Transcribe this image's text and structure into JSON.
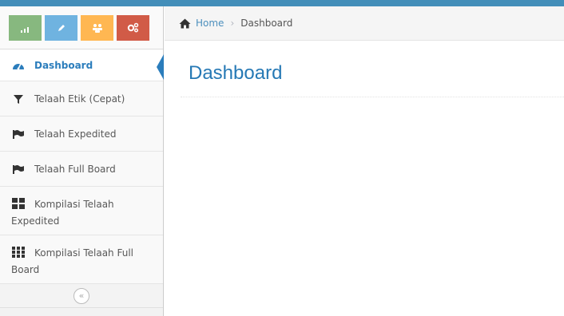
{
  "colors": {
    "topbar": "#438eb9",
    "btn_success": "#87b87f",
    "btn_info": "#6fb3e0",
    "btn_warning": "#ffb752",
    "btn_danger": "#d15b47",
    "accent": "#2b7dbc"
  },
  "shortcuts": [
    {
      "icon": "signal-icon"
    },
    {
      "icon": "pencil-icon"
    },
    {
      "icon": "users-icon"
    },
    {
      "icon": "cogs-icon"
    }
  ],
  "sidebar": {
    "items": [
      {
        "label": "Dashboard",
        "icon": "tachometer-icon",
        "active": true
      },
      {
        "label": "Telaah Etik (Cepat)",
        "icon": "filter-icon"
      },
      {
        "label": "Telaah Expedited",
        "icon": "flag-icon"
      },
      {
        "label": "Telaah Full Board",
        "icon": "flag-icon"
      },
      {
        "label": "Kompilasi Telaah Expedited",
        "icon": "th-large-icon"
      },
      {
        "label": "Kompilasi Telaah Full Board",
        "icon": "th-icon"
      }
    ],
    "collapse_glyph": "«"
  },
  "breadcrumb": {
    "home": "Home",
    "separator": "›",
    "current": "Dashboard"
  },
  "page": {
    "title": "Dashboard"
  }
}
